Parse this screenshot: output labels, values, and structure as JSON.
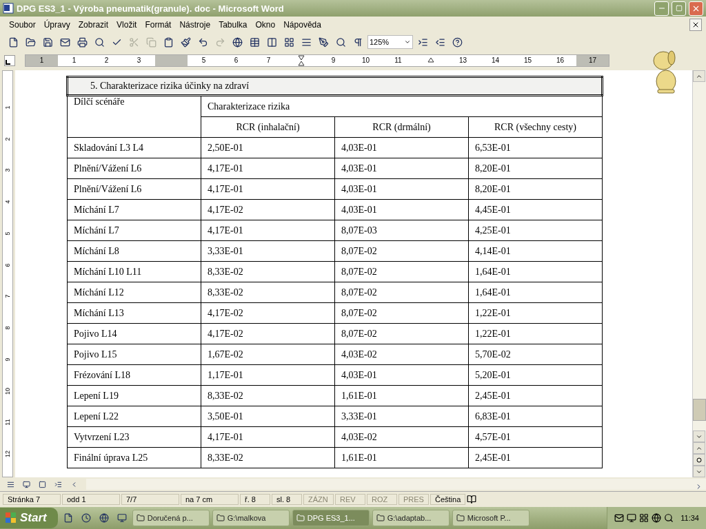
{
  "window": {
    "title": "DPG ES3_1 - Výroba pneumatik(granule). doc - Microsoft Word"
  },
  "menu": [
    "Soubor",
    "Úpravy",
    "Zobrazit",
    "Vložit",
    "Formát",
    "Nástroje",
    "Tabulka",
    "Okno",
    "Nápověda"
  ],
  "toolbar": {
    "zoom": "125%"
  },
  "ruler": [
    {
      "kind": "gray",
      "label": "1"
    },
    {
      "kind": "number",
      "label": "1"
    },
    {
      "kind": "number",
      "label": "2"
    },
    {
      "kind": "number",
      "label": "3"
    },
    {
      "kind": "margin"
    },
    {
      "kind": "number",
      "label": "5"
    },
    {
      "kind": "number",
      "label": "6"
    },
    {
      "kind": "number",
      "label": "7"
    },
    {
      "kind": "indent"
    },
    {
      "kind": "number",
      "label": "9"
    },
    {
      "kind": "number",
      "label": "10"
    },
    {
      "kind": "number",
      "label": "11"
    },
    {
      "kind": "tab"
    },
    {
      "kind": "number",
      "label": "13"
    },
    {
      "kind": "number",
      "label": "14"
    },
    {
      "kind": "number",
      "label": "15"
    },
    {
      "kind": "number",
      "label": "16"
    },
    {
      "kind": "gray",
      "label": "17"
    }
  ],
  "vertical_ruler": [
    "1",
    "2",
    "3",
    "4",
    "5",
    "6",
    "7",
    "8",
    "9",
    "10",
    "11",
    "12"
  ],
  "table": {
    "title": "5. Charakterizace rizika účinky na zdraví",
    "row_header": "Dílčí scénáře",
    "group_header": "Charakterizace rizika",
    "columns": [
      "",
      "RCR (inhalační)",
      "RCR (drmální)",
      "RCR (všechny cesty)"
    ],
    "rows": [
      [
        "Skladování L3 L4",
        "2,50E-01",
        "4,03E-01",
        "6,53E-01"
      ],
      [
        "Plnění/Vážení L6",
        "4,17E-01",
        "4,03E-01",
        "8,20E-01"
      ],
      [
        "Plnění/Vážení L6",
        "4,17E-01",
        "4,03E-01",
        "8,20E-01"
      ],
      [
        "Míchání L7",
        "4,17E-02",
        "4,03E-01",
        "4,45E-01"
      ],
      [
        "Míchání L7",
        "4,17E-01",
        "8,07E-03",
        "4,25E-01"
      ],
      [
        "Míchání L8",
        "3,33E-01",
        "8,07E-02",
        "4,14E-01"
      ],
      [
        "Míchání L10 L11",
        "8,33E-02",
        "8,07E-02",
        "1,64E-01"
      ],
      [
        "Míchání L12",
        "8,33E-02",
        "8,07E-02",
        "1,64E-01"
      ],
      [
        "Míchání L13",
        "4,17E-02",
        "8,07E-02",
        "1,22E-01"
      ],
      [
        "Pojivo L14",
        "4,17E-02",
        "8,07E-02",
        "1,22E-01"
      ],
      [
        "Pojivo L15",
        "1,67E-02",
        "4,03E-02",
        "5,70E-02"
      ],
      [
        "Frézování L18",
        "1,17E-01",
        "4,03E-01",
        "5,20E-01"
      ],
      [
        "Lepení L19",
        "8,33E-02",
        "1,61E-01",
        "2,45E-01"
      ],
      [
        "Lepení L22",
        "3,50E-01",
        "3,33E-01",
        "6,83E-01"
      ],
      [
        "Vytvrzení L23",
        "4,17E-01",
        "4,03E-02",
        "4,57E-01"
      ],
      [
        "Finální úprava L25",
        "8,33E-02",
        "1,61E-01",
        "2,45E-01"
      ]
    ]
  },
  "status_bar": [
    {
      "text": "Stránka 7",
      "disabled": false
    },
    {
      "text": "odd 1",
      "disabled": false
    },
    {
      "text": "7/7",
      "disabled": false
    },
    {
      "text": "na 7 cm",
      "disabled": false
    },
    {
      "text": "ř. 8",
      "disabled": false
    },
    {
      "text": "sl. 8",
      "disabled": false
    },
    {
      "text": "ZÁZN",
      "disabled": true
    },
    {
      "text": "REV",
      "disabled": true
    },
    {
      "text": "ROZ",
      "disabled": true
    },
    {
      "text": "PRES",
      "disabled": true
    },
    {
      "text": "Čeština",
      "disabled": false
    }
  ],
  "taskbar": {
    "start": "Start",
    "tasks": [
      {
        "label": "Doručená p...",
        "selected": false
      },
      {
        "label": "G:\\malkova",
        "selected": false
      },
      {
        "label": "DPG ES3_1...",
        "selected": true
      },
      {
        "label": "G:\\adaptab...",
        "selected": false
      },
      {
        "label": "Microsoft P...",
        "selected": false
      }
    ],
    "clock": "11:34"
  }
}
